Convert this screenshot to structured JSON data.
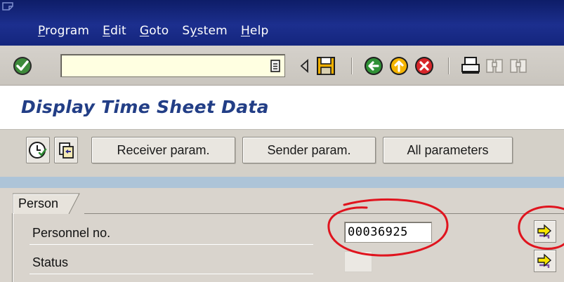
{
  "menubar": {
    "items": [
      {
        "label": "Program",
        "mnemonic": "P",
        "rest": "rogram"
      },
      {
        "label": "Edit",
        "mnemonic": "E",
        "rest": "dit"
      },
      {
        "label": "Goto",
        "mnemonic": "G",
        "rest": "oto"
      },
      {
        "label": "System",
        "mnemonic": "",
        "pre": "S",
        "mid": "y",
        "rest": "stem"
      },
      {
        "label": "Help",
        "mnemonic": "H",
        "rest": "elp"
      }
    ]
  },
  "toolbar": {
    "command_value": "",
    "icons": [
      "enter-icon",
      "command-history-icon",
      "back-arrow-icon",
      "save-icon",
      "back-icon",
      "exit-icon",
      "cancel-icon",
      "print-icon",
      "find-icon",
      "find-next-icon"
    ]
  },
  "title": "Display Time Sheet Data",
  "app_toolbar": {
    "buttons": [
      {
        "label": "Receiver param."
      },
      {
        "label": "Sender param."
      },
      {
        "label": "All parameters"
      }
    ],
    "icons": [
      "execute-clock-icon",
      "copy-icon"
    ]
  },
  "person": {
    "tab_label": "Person",
    "personnel_label": "Personnel no.",
    "personnel_value": "00036925",
    "status_label": "Status",
    "status_value": ""
  },
  "colors": {
    "menubar": "#1c2f8e",
    "title_text": "#223e86",
    "annotation": "#e0141e",
    "command_field": "#ffffe1"
  }
}
